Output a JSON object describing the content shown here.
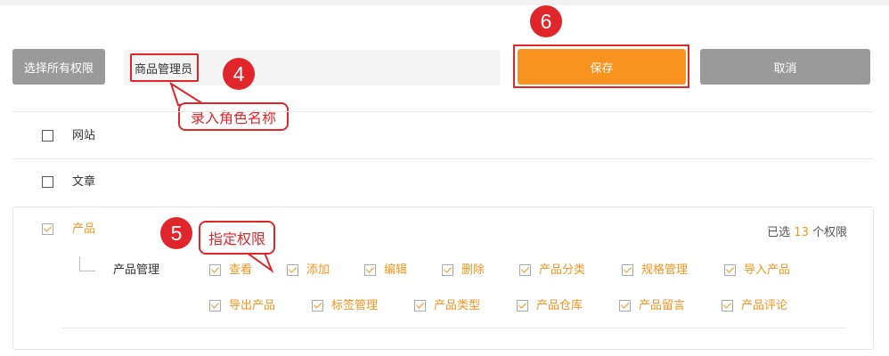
{
  "toolbar": {
    "select_all_label": "选择所有权限",
    "role_name_value": "商品管理员",
    "save_label": "保存",
    "cancel_label": "取消"
  },
  "annotations": {
    "step4": "4",
    "step4_text": "录入角色名称",
    "step5": "5",
    "step5_text": "指定权限",
    "step6": "6"
  },
  "modules": [
    {
      "label": "网站",
      "checked": false
    },
    {
      "label": "文章",
      "checked": false
    },
    {
      "label": "产品",
      "checked": true
    }
  ],
  "selected_count": {
    "prefix": "已选",
    "count": "13",
    "suffix": "个权限"
  },
  "product_group": {
    "label": "产品管理",
    "row1": [
      "查看",
      "添加",
      "编辑",
      "删除",
      "产品分类",
      "规格管理",
      "导入产品"
    ],
    "row2": [
      "导出产品",
      "标签管理",
      "产品类型",
      "产品仓库",
      "产品留言",
      "产品评论"
    ]
  },
  "colors": {
    "accent": "#f7931e",
    "annotation_red": "#e0262b",
    "gray_button": "#9a9a9a"
  }
}
